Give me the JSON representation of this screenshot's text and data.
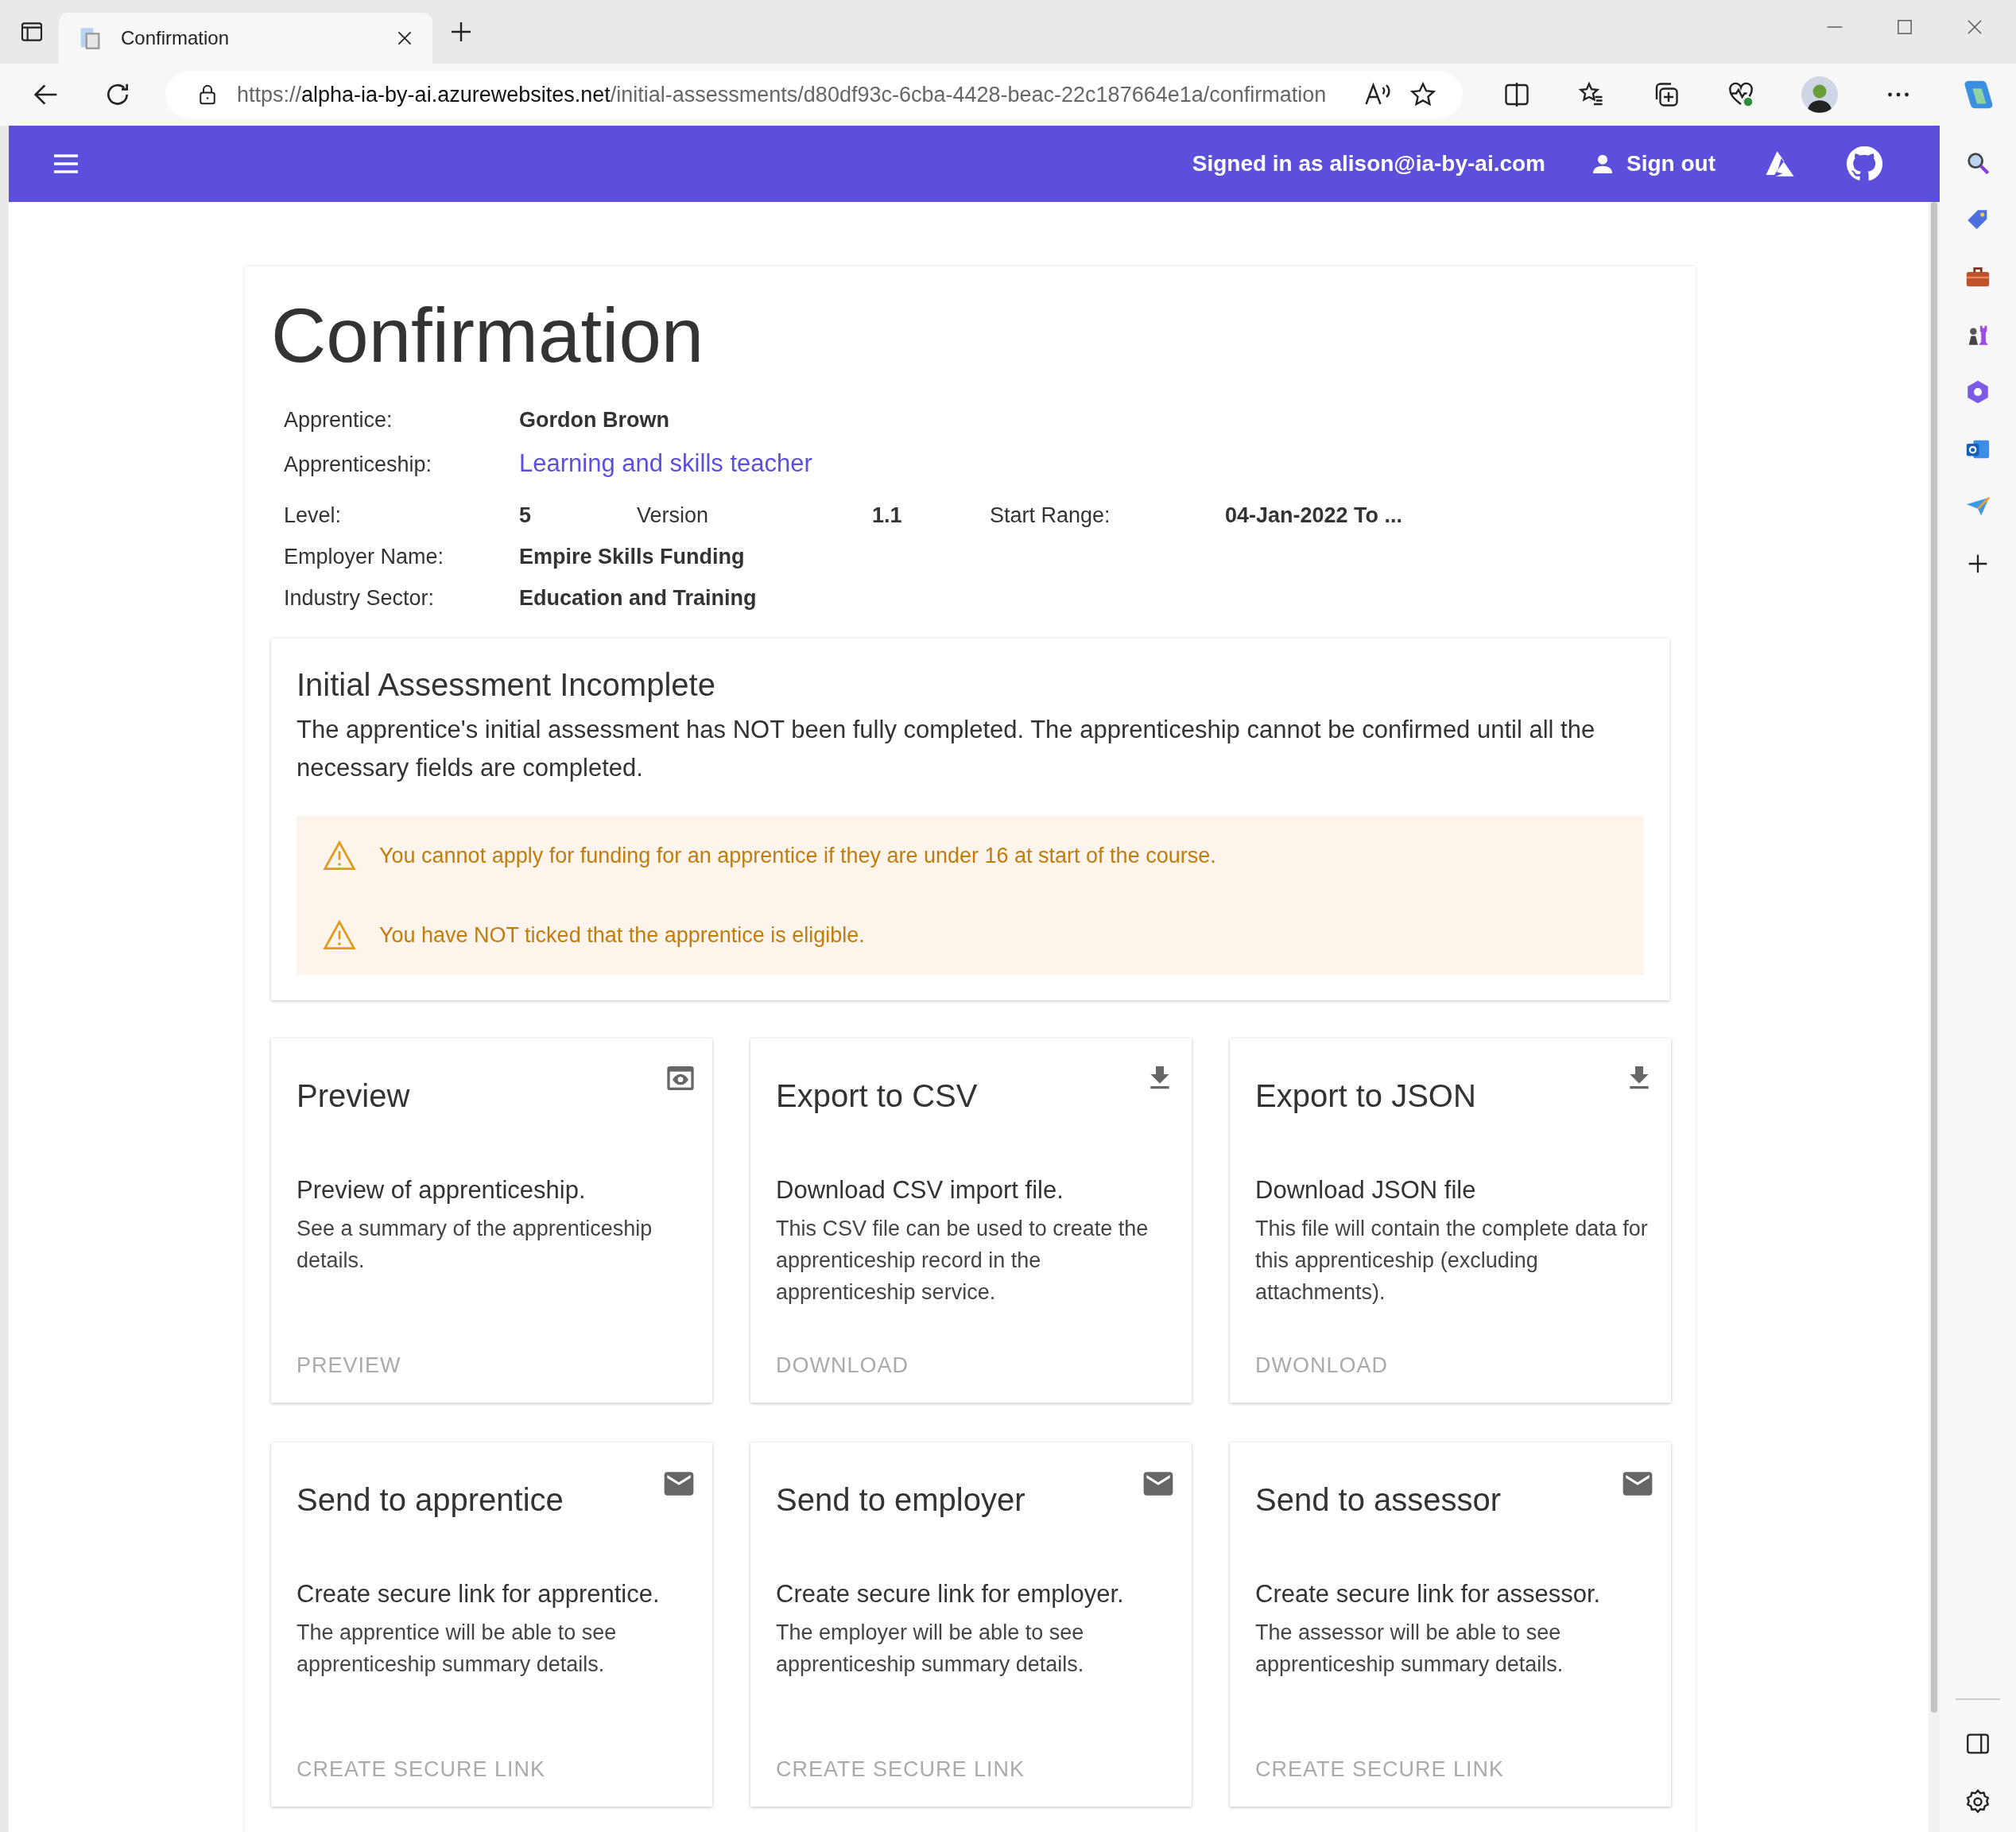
{
  "browser": {
    "tab_title": "Confirmation",
    "url": {
      "scheme": "https://",
      "host": "alpha-ia-by-ai.azurewebsites.net",
      "path": "/initial-assessments/d80df93c-6cba-4428-beac-22c187664e1a/confirmation"
    }
  },
  "header": {
    "signed_in": "Signed in as alison@ia-by-ai.com",
    "sign_out": "Sign out"
  },
  "page": {
    "title": "Confirmation",
    "details": [
      [
        {
          "label": "Apprentice:",
          "value": "Gordon Brown",
          "kind": "text"
        }
      ],
      [
        {
          "label": "Apprenticeship:",
          "value": "Learning and skills teacher",
          "kind": "link"
        }
      ],
      [
        {
          "label": "Level:",
          "value": "5",
          "kind": "text"
        },
        {
          "label": "Version",
          "value": "1.1",
          "kind": "text"
        },
        {
          "label": "Start Range:",
          "value": "04-Jan-2022 To ...",
          "kind": "text"
        }
      ],
      [
        {
          "label": "Employer Name:",
          "value": "Empire Skills Funding",
          "kind": "text"
        }
      ],
      [
        {
          "label": "Industry Sector:",
          "value": "Education and Training",
          "kind": "text"
        }
      ]
    ],
    "alert": {
      "title": "Initial Assessment Incomplete",
      "message": "The apprentice's initial assessment has NOT been fully completed. The apprenticeship cannot be confirmed until all the necessary fields are completed.",
      "warnings": [
        "You cannot apply for funding for an apprentice if they are under 16 at start of the course.",
        "You have NOT ticked that the apprentice is eligible."
      ]
    },
    "cards": [
      {
        "kind": "preview",
        "title": "Preview",
        "subtitle": "Preview of apprenticeship.",
        "body": "See a summary of the apprenticeship details.",
        "action": "PREVIEW",
        "disabled": true
      },
      {
        "kind": "download",
        "title": "Export to CSV",
        "subtitle": "Download CSV import file.",
        "body": "This CSV file can be used to create the apprenticeship record in the apprenticeship service.",
        "action": "DOWNLOAD",
        "disabled": true
      },
      {
        "kind": "download",
        "title": "Export to JSON",
        "subtitle": "Download JSON file",
        "body": "This file will contain the complete data for this apprenticeship (excluding attachments).",
        "action": "DWONLOAD",
        "disabled": true
      },
      {
        "kind": "mail",
        "title": "Send to apprentice",
        "subtitle": "Create secure link for apprentice.",
        "body": "The apprentice will be able to see apprenticeship summary details.",
        "action": "CREATE SECURE LINK",
        "disabled": true
      },
      {
        "kind": "mail",
        "title": "Send to employer",
        "subtitle": "Create secure link for employer.",
        "body": "The employer will be able to see apprenticeship summary details.",
        "action": "CREATE SECURE LINK",
        "disabled": true
      },
      {
        "kind": "mail",
        "title": "Send to assessor",
        "subtitle": "Create secure link for assessor.",
        "body": "The assessor will be able to see apprenticeship summary details.",
        "action": "CREATE SECURE LINK",
        "disabled": true
      }
    ]
  }
}
